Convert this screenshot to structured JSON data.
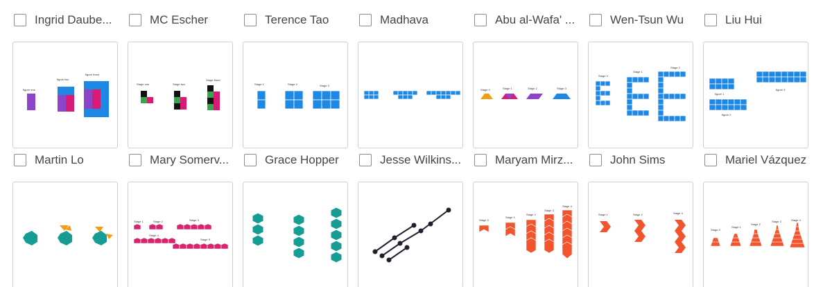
{
  "cards": [
    {
      "title": "Ingrid Daube...",
      "stage_labels": [
        "figure one",
        "figure two",
        "figure three"
      ]
    },
    {
      "title": "MC Escher",
      "stage_labels": [
        "Stage one",
        "Stage two",
        "Stage three"
      ]
    },
    {
      "title": "Terence Tao",
      "stage_labels": [
        "Stage 1",
        "Stage 2",
        "Stage 3"
      ]
    },
    {
      "title": "Madhava",
      "stage_labels": []
    },
    {
      "title": "Abu al-Wafa' ...",
      "stage_labels": [
        "Stage 0",
        "Stage 1",
        "Stage 2",
        "Stage 3"
      ]
    },
    {
      "title": "Wen-Tsun Wu",
      "stage_labels": [
        "Stage 0",
        "Stage 1",
        "Stage 2"
      ]
    },
    {
      "title": "Liu Hui",
      "stage_labels": [
        "figure 1",
        "figure 2",
        "figure 3"
      ]
    },
    {
      "title": "Martin Lo",
      "stage_labels": []
    },
    {
      "title": "Mary Somerv...",
      "stage_labels": [
        "Stage 1",
        "Stage 2",
        "Stage 3",
        "Stage 4",
        "Stage 5"
      ]
    },
    {
      "title": "Grace Hopper",
      "stage_labels": []
    },
    {
      "title": "Jesse Wilkins...",
      "stage_labels": []
    },
    {
      "title": "Maryam Mirz...",
      "stage_labels": [
        "Stage 0",
        "Stage 1",
        "Stage 2",
        "Stage 3",
        "Stage 4"
      ]
    },
    {
      "title": "John Sims",
      "stage_labels": [
        "Stage 1",
        "Stage 2",
        "Stage 3"
      ]
    },
    {
      "title": "Mariel Vázquez",
      "stage_labels": [
        "Stage 0",
        "Stage 1",
        "Stage 2",
        "Stage 3",
        "Stage 4"
      ]
    }
  ],
  "colors": {
    "blue": "#1e88e5",
    "purple": "#8e44c9",
    "magenta": "#d81b74",
    "green": "#2eaa4a",
    "black": "#111111",
    "teal": "#159c93",
    "orange": "#f39c12",
    "red_orange": "#f2542d",
    "crimson": "#d6246e",
    "navy": "#1f1f2e"
  }
}
